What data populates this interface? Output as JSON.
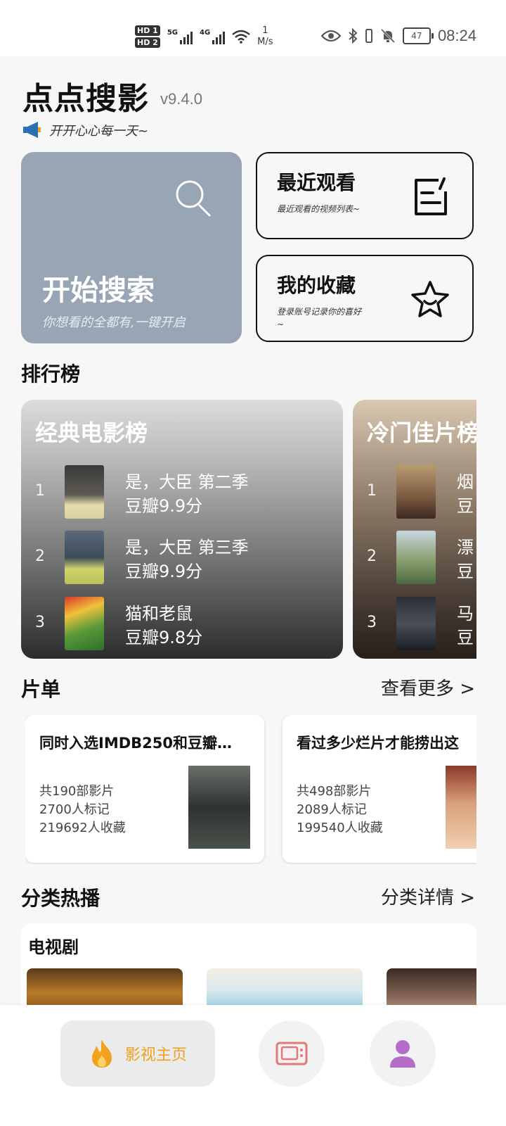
{
  "status_bar": {
    "hd1": "HD 1",
    "hd2": "HD 2",
    "net1": "5G",
    "net2": "4G",
    "speed_value": "1",
    "speed_unit": "M/s",
    "battery": "47",
    "time": "08:24"
  },
  "header": {
    "title": "点点搜影",
    "version": "v9.4.0",
    "announcement": "开开心心每一天~"
  },
  "quick": {
    "search": {
      "title": "开始搜索",
      "subtitle": "你想看的全都有,一键开启"
    },
    "recent": {
      "title": "最近观看",
      "subtitle": "最近观看的视频列表~"
    },
    "favorites": {
      "title": "我的收藏",
      "subtitle": "登录账号记录你的喜好~"
    }
  },
  "ranking": {
    "heading": "排行榜",
    "boards": [
      {
        "title": "经典电影榜",
        "items": [
          {
            "rank": "1",
            "name": "是，大臣  第二季",
            "score": "豆瓣9.9分"
          },
          {
            "rank": "2",
            "name": "是，大臣  第三季",
            "score": "豆瓣9.9分"
          },
          {
            "rank": "3",
            "name": "猫和老鼠",
            "score": "豆瓣9.8分"
          }
        ]
      },
      {
        "title": "冷门佳片榜",
        "items": [
          {
            "rank": "1",
            "name": "烟",
            "score": "豆"
          },
          {
            "rank": "2",
            "name": "漂",
            "score": "豆"
          },
          {
            "rank": "3",
            "name": "马",
            "score": "豆"
          }
        ]
      }
    ]
  },
  "film_lists": {
    "heading": "片单",
    "more": "查看更多 >",
    "cards": [
      {
        "title": "同时入选IMDB250和豆瓣…",
        "films": "共190部影片",
        "marked": "2700人标记",
        "saved": "219692人收藏"
      },
      {
        "title": "看过多少烂片才能捞出这",
        "films": "共498部影片",
        "marked": "2089人标记",
        "saved": "199540人收藏"
      }
    ]
  },
  "category": {
    "heading": "分类热播",
    "more": "分类详情 >",
    "panel_title": "电视剧"
  },
  "nav": {
    "home_label": "影视主页",
    "accent": "#f0a21d"
  }
}
